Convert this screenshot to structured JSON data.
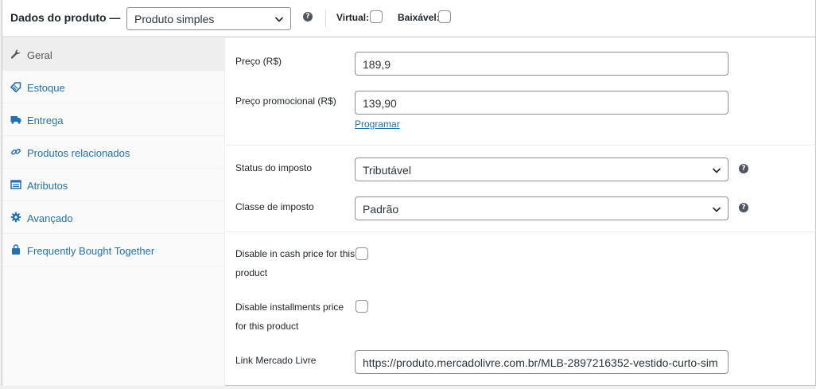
{
  "header": {
    "title": "Dados do produto —",
    "product_type": "Produto simples",
    "virtual_label": "Virtual:",
    "downloadable_label": "Baixável:",
    "virtual_checked": false,
    "downloadable_checked": false
  },
  "tabs": [
    {
      "label": "Geral",
      "icon": "wrench-icon",
      "active": true
    },
    {
      "label": "Estoque",
      "icon": "tag-icon",
      "active": false
    },
    {
      "label": "Entrega",
      "icon": "truck-icon",
      "active": false
    },
    {
      "label": "Produtos relacionados",
      "icon": "link-icon",
      "active": false
    },
    {
      "label": "Atributos",
      "icon": "list-icon",
      "active": false
    },
    {
      "label": "Avançado",
      "icon": "gear-icon",
      "active": false
    },
    {
      "label": "Frequently Bought Together",
      "icon": "bag-icon",
      "active": false
    }
  ],
  "general": {
    "price_label": "Preço (R$)",
    "price_value": "189,9",
    "sale_price_label": "Preço promocional (R$)",
    "sale_price_value": "139,90",
    "schedule_link": "Programar",
    "tax_status_label": "Status do imposto",
    "tax_status_value": "Tributável",
    "tax_class_label": "Classe de imposto",
    "tax_class_value": "Padrão",
    "disable_cash_label_line1": "Disable in cash price for this",
    "disable_cash_label_line2": "product",
    "disable_cash_checked": false,
    "disable_installments_label_line1": "Disable installments price",
    "disable_installments_label_line2": "for this product",
    "disable_installments_checked": false,
    "ml_link_label": "Link Mercado Livre",
    "ml_link_value": "https://produto.mercadolivre.com.br/MLB-2897216352-vestido-curto-sim"
  },
  "colors": {
    "link": "#2271b1",
    "border": "#8c8f94",
    "active_tab_bg": "#eeeeee",
    "icon": "#2271b1"
  }
}
